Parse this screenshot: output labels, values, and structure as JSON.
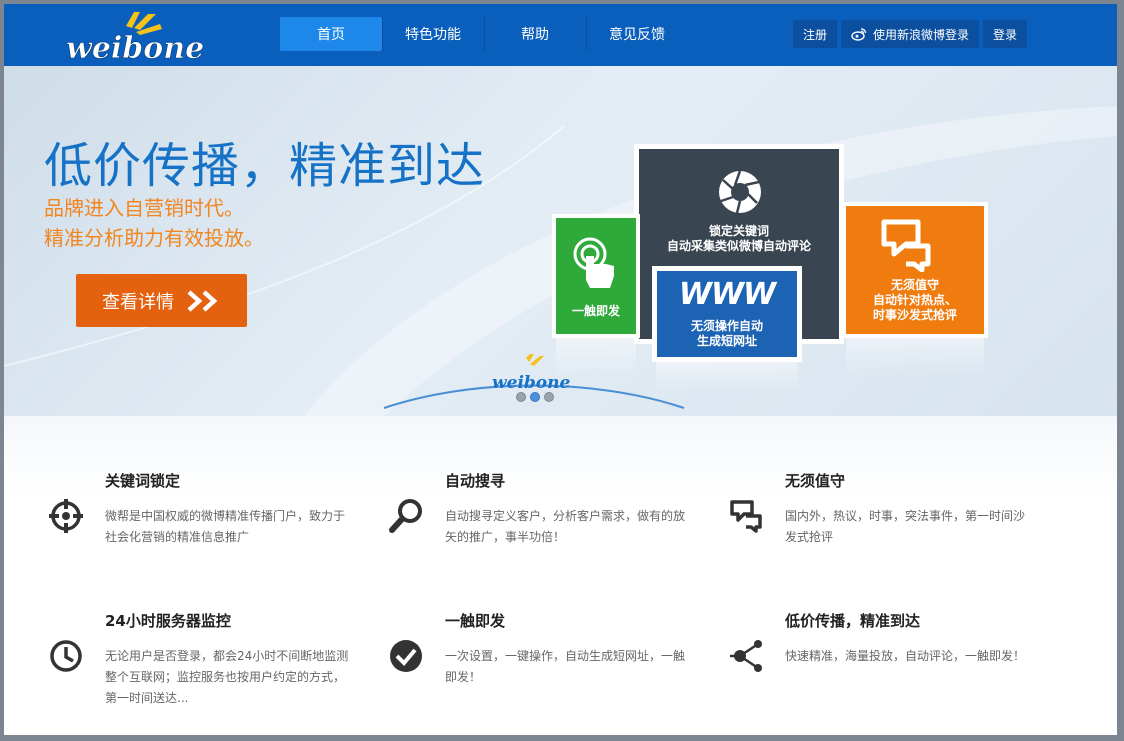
{
  "header": {
    "logo_text": "weibone",
    "nav": [
      {
        "label": "首页",
        "active": true
      },
      {
        "label": "特色功能",
        "active": false
      },
      {
        "label": "帮助",
        "active": false
      },
      {
        "label": "意见反馈",
        "active": false
      }
    ],
    "register_label": "注册",
    "weibo_login_label": "使用新浪微博登录",
    "login_label": "登录"
  },
  "banner": {
    "headline": "低价传播，精准到达",
    "subline1": "品牌进入自营销时代。",
    "subline2": "精准分析助力有效投放。",
    "cta_label": "查看详情",
    "tiles": {
      "green": "一触即发",
      "dark_line1": "锁定关键词",
      "dark_line2": "自动采集类似微博自动评论",
      "orange_line1": "无须值守",
      "orange_line2": "自动针对热点、",
      "orange_line3": "时事沙发式抢评",
      "blue_line1": "无须操作自动",
      "blue_line2": "生成短网址",
      "www": "WWW"
    },
    "small_logo_text": "weibone",
    "slides": 3,
    "active_slide": 2
  },
  "features": [
    {
      "title": "关键词锁定",
      "desc": "微帮是中国权威的微博精准传播门户，致力于社会化营销的精准信息推广",
      "icon": "target-icon"
    },
    {
      "title": "自动搜寻",
      "desc": "自动搜寻定义客户，分析客户需求，做有的放矢的推广，事半功倍！",
      "icon": "magnifier-icon"
    },
    {
      "title": "无须值守",
      "desc": "国内外，热议，时事，突法事件，第一时间沙发式抢评",
      "icon": "speech-bubble-icon"
    },
    {
      "title": "24小时服务器监控",
      "desc": "无论用户是否登录，都会24小时不间断地监测整个互联网；监控服务也按用户约定的方式，第一时间送达...",
      "icon": "clock-icon"
    },
    {
      "title": "一触即发",
      "desc": "一次设置，一键操作，自动生成短网址，一触即发！",
      "icon": "check-circle-icon"
    },
    {
      "title": "低价传播，精准到达",
      "desc": "快速精准，海量投放，自动评论，一触即发！",
      "icon": "share-icon"
    }
  ],
  "colors": {
    "header_bg": "#0a5fbd",
    "nav_active": "#1e88ea",
    "headline": "#1572c6",
    "subline": "#f2851e",
    "cta": "#e3610f"
  }
}
